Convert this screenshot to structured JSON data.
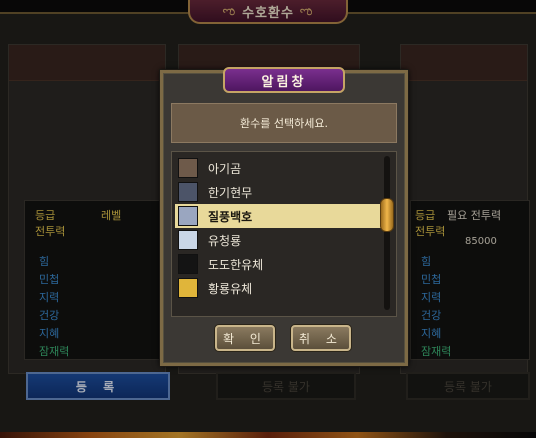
{
  "window": {
    "title": "수호환수"
  },
  "left_panel": {
    "grade_label": "등급",
    "level_label": "레벨",
    "power_label": "전투력",
    "stats": [
      "힘",
      "민첩",
      "지력",
      "건강",
      "지혜"
    ],
    "potential_label": "잠재력",
    "register_button": "등 록"
  },
  "middle_panel": {
    "button": "등록 불가"
  },
  "right_panel": {
    "grade_label": "등급",
    "required_label": "필요 전투력",
    "power_label": "전투력",
    "required_value": "85000",
    "stats": [
      "힘",
      "민첩",
      "지력",
      "건강",
      "지혜"
    ],
    "potential_label": "잠재력",
    "button": "등록 불가"
  },
  "dialog": {
    "title": "알림창",
    "message": "환수를 선택하세요.",
    "items": [
      {
        "label": "아기곰",
        "icon": "bear-cub-icon",
        "color": "#6e5a4a",
        "selected": false
      },
      {
        "label": "한기현무",
        "icon": "black-tortoise-icon",
        "color": "#4c5468",
        "selected": false
      },
      {
        "label": "질풍백호",
        "icon": "white-tiger-icon",
        "color": "#9aa6c0",
        "selected": true
      },
      {
        "label": "유청룡",
        "icon": "blue-dragon-icon",
        "color": "#c9d6e6",
        "selected": false
      },
      {
        "label": "도도한유체",
        "icon": "black-spirit-icon",
        "color": "#141414",
        "selected": false
      },
      {
        "label": "황룡유체",
        "icon": "golden-dragon-icon",
        "color": "#e0b53a",
        "selected": false
      }
    ],
    "confirm_button": "확 인",
    "cancel_button": "취 소"
  }
}
